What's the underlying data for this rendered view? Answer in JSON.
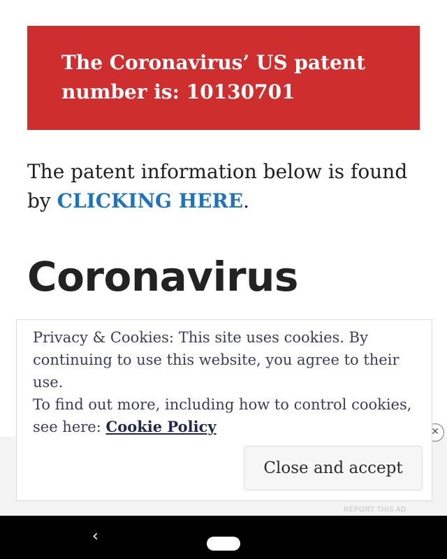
{
  "banner": {
    "text": "The Coronavirus’ US patent number is: 10130701"
  },
  "intro": {
    "prefix": "The patent information below is found by ",
    "link_label": "CLICKING HERE",
    "suffix": "."
  },
  "heading": "Coronavirus",
  "cookie_notice": {
    "line1": "Privacy & Cookies: This site uses cookies. By continuing to use this website, you agree to their use.",
    "line2_prefix": "To find out more, including how to control cookies, see here: ",
    "policy_link": "Cookie Policy",
    "close_button": "Close and accept"
  },
  "ad": {
    "report_label": "REPORT THIS AD",
    "close_symbol": "✕"
  },
  "android_nav": {
    "back_symbol": "‹"
  },
  "colors": {
    "banner_bg": "#cf2e2e",
    "link": "#1e73be",
    "nav_bar": "#000000"
  }
}
